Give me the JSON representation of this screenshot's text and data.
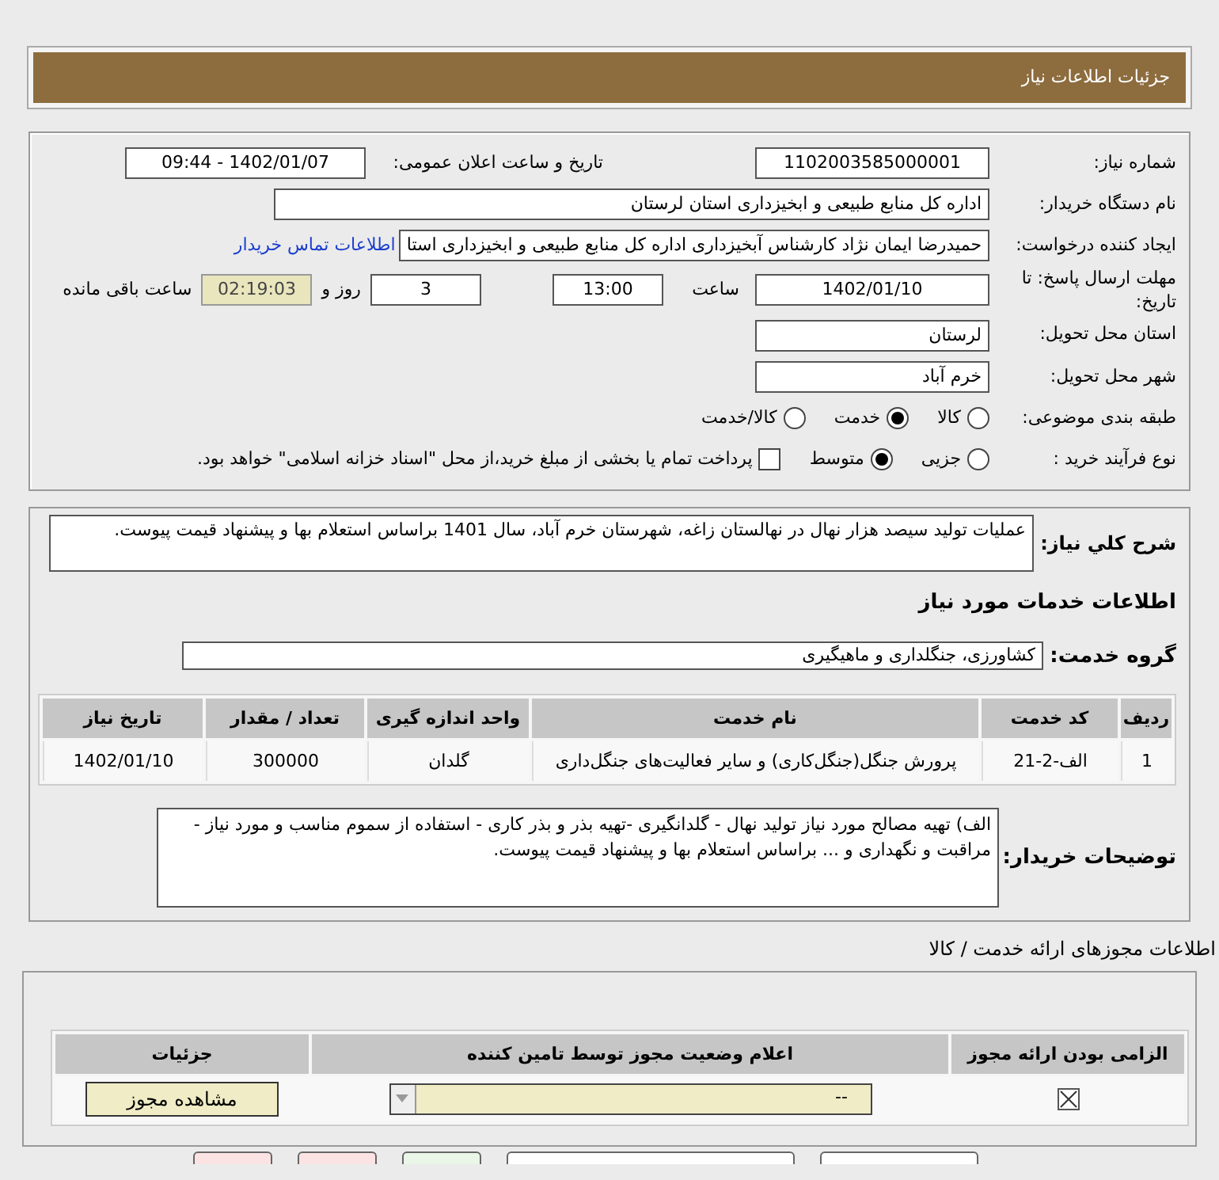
{
  "header": {
    "title": "جزئیات اطلاعات نیاز"
  },
  "details": {
    "need_number": {
      "label": "شماره نیاز:",
      "value": "1102003585000001"
    },
    "announce": {
      "label": "تاریخ و ساعت اعلان عمومی:",
      "value": "1402/01/07 - 09:44"
    },
    "buyer": {
      "label": "نام دستگاه خریدار:",
      "value": "اداره کل منابع طبیعی و ابخیزداری استان لرستان"
    },
    "creator": {
      "label": "ایجاد کننده درخواست:",
      "value": "حمیدرضا ایمان نژاد کارشناس آبخیزداری اداره کل منابع طبیعی و ابخیزداری استا",
      "link": "اطلاعات تماس خریدار"
    },
    "deadline": {
      "label": "مهلت ارسال پاسخ: تا تاریخ:",
      "date": "1402/01/10",
      "time_label": "ساعت",
      "time": "13:00",
      "days": "3",
      "days_label": "روز و",
      "remaining": "02:19:03",
      "remaining_label": "ساعت باقی مانده"
    },
    "province": {
      "label": "استان محل تحویل:",
      "value": "لرستان"
    },
    "city": {
      "label": "شهر محل تحویل:",
      "value": "خرم آباد"
    },
    "category": {
      "label": "طبقه بندی موضوعی:",
      "options": [
        {
          "label": "کالا",
          "selected": false
        },
        {
          "label": "خدمت",
          "selected": true
        },
        {
          "label": "کالا/خدمت",
          "selected": false
        }
      ]
    },
    "process": {
      "label": "نوع فرآیند خرید :",
      "options": [
        {
          "label": "جزیی",
          "selected": false
        },
        {
          "label": "متوسط",
          "selected": true
        }
      ],
      "payment": {
        "label": "پرداخت تمام یا بخشی از مبلغ خرید،از محل \"اسناد خزانه اسلامی\" خواهد بود.",
        "checked": false
      }
    }
  },
  "summary": {
    "label": "شرح کلي نياز:",
    "value": "عملیات تولید سیصد هزار نهال در نهالستان زاغه، شهرستان خرم آباد، سال 1401 براساس استعلام بها و پیشنهاد قیمت پیوست."
  },
  "services_heading": "اطلاعات خدمات مورد نیاز",
  "service_group": {
    "label": "گروه خدمت:",
    "value": "کشاورزی، جنگلداری و ماهیگیری"
  },
  "services_table": {
    "columns": [
      "ردیف",
      "کد خدمت",
      "نام خدمت",
      "واحد اندازه گیری",
      "تعداد / مقدار",
      "تاریخ نیاز"
    ],
    "rows": [
      [
        "1",
        "الف-2-21",
        "پرورش جنگل(جنگل‌کاری) و سایر فعالیت‌های جنگل‌داری",
        "گلدان",
        "300000",
        "1402/01/10"
      ]
    ]
  },
  "buyer_notes": {
    "label": "توضیحات خریدار:",
    "value": "الف) تهیه مصالح مورد نیاز تولید نهال - گلدانگیری -تهیه بذر و  بذر کاری - استفاده از سموم مناسب و مورد نیاز - مراقبت و نگهداری و ... براساس استعلام بها و پیشنهاد قیمت پیوست."
  },
  "licenses_heading": "اطلاعات مجوزهای ارائه خدمت / کالا",
  "licenses_table": {
    "columns": [
      "الزامی بودن ارائه مجوز",
      "اعلام وضعیت مجوز توسط تامین کننده",
      "جزئیات"
    ],
    "rows": [
      {
        "required": true,
        "status": "--",
        "button": "مشاهده مجوز"
      }
    ]
  }
}
